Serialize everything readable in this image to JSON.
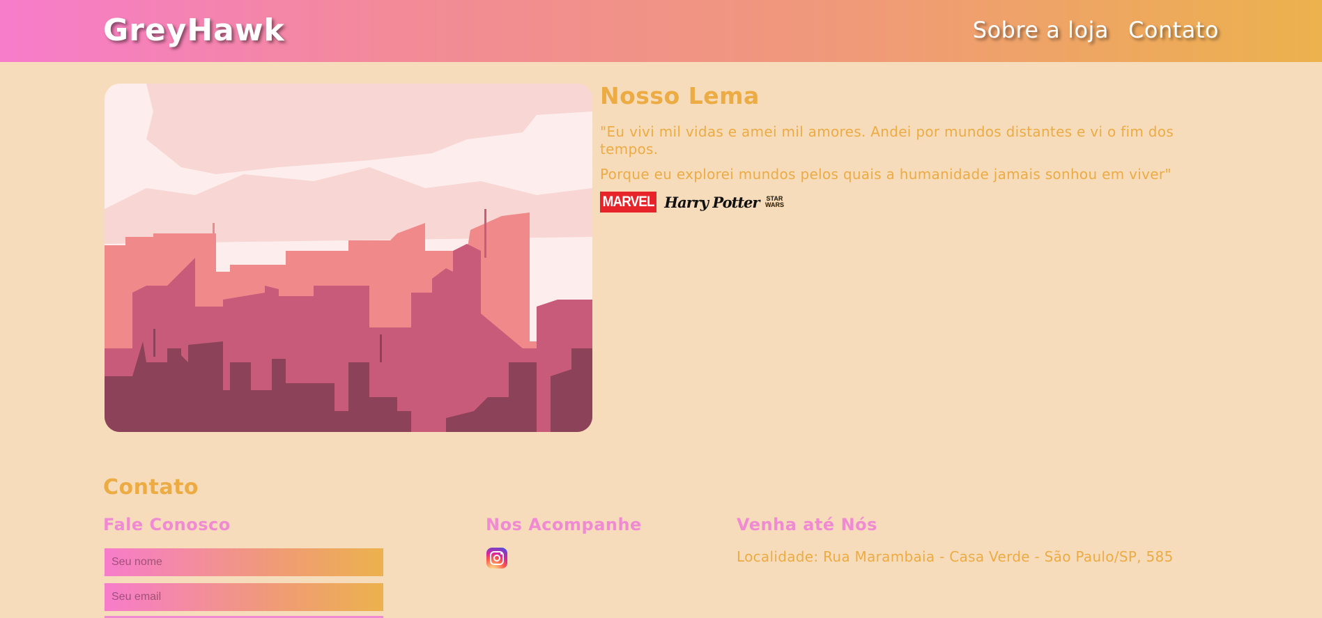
{
  "header": {
    "logo": "GreyHawk",
    "nav": [
      {
        "label": "Sobre a loja"
      },
      {
        "label": "Contato"
      }
    ]
  },
  "motto": {
    "title": "Nosso Lema",
    "quote_line1": "\"Eu vivi mil vidas e amei mil amores. Andei por mundos distantes e vi o fim dos tempos.",
    "quote_line2": "Porque eu explorei mundos pelos quais a humanidade jamais sonhou em viver\"",
    "brands": [
      "MARVEL",
      "Harry Potter",
      "STAR WARS"
    ]
  },
  "contact": {
    "title": "Contato",
    "form_title": "Fale Conosco",
    "name_placeholder": "Seu nome",
    "email_placeholder": "Seu email",
    "social_title": "Nos Acompanhe",
    "social_icon": "instagram-icon",
    "location_title": "Venha até Nós",
    "location_text": "Localidade: Rua Marambaia - Casa Verde - São Paulo/SP, 585"
  },
  "colors": {
    "background": "#f6dcbb",
    "accent_gold": "#ecab43",
    "accent_pink": "#f08bd3",
    "header_gradient_start": "#f77ccb",
    "header_gradient_end": "#ecb24d"
  }
}
